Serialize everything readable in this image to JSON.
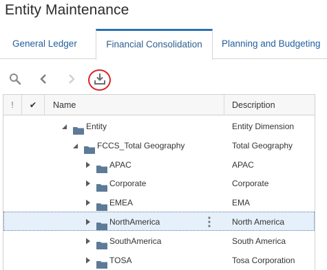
{
  "page": {
    "title": "Entity Maintenance"
  },
  "tabs": [
    {
      "label": "General Ledger",
      "active": false
    },
    {
      "label": "Financial Consolidation",
      "active": true
    },
    {
      "label": "Planning and Budgeting",
      "active": false
    }
  ],
  "toolbar": {
    "search_icon": "search-icon",
    "prev_icon": "chevron-left-icon",
    "next_icon": "chevron-right-icon",
    "export_icon": "download-icon",
    "highlight_color": "#d9242a"
  },
  "grid": {
    "columns": {
      "flag": "!",
      "check": "✔",
      "name": "Name",
      "description": "Description"
    },
    "rows": [
      {
        "name": "Entity",
        "description": "Entity Dimension",
        "expanded": true,
        "level": 0
      },
      {
        "name": "FCCS_Total Geography",
        "description": "Total Geography",
        "expanded": true,
        "level": 1
      },
      {
        "name": "APAC",
        "description": "APAC",
        "expanded": false,
        "level": 2
      },
      {
        "name": "Corporate",
        "description": "Corporate",
        "expanded": false,
        "level": 2
      },
      {
        "name": "EMEA",
        "description": "EMA",
        "expanded": false,
        "level": 2
      },
      {
        "name": "NorthAmerica",
        "description": "North America",
        "expanded": false,
        "level": 2,
        "selected": true
      },
      {
        "name": "SouthAmerica",
        "description": "South America",
        "expanded": false,
        "level": 2
      },
      {
        "name": "TOSA",
        "description": "Tosa Corporation",
        "expanded": false,
        "level": 2
      }
    ]
  },
  "colors": {
    "accent": "#2a6fb5",
    "folder": "#5d7a96",
    "selected_row": "#e6f0fa"
  }
}
